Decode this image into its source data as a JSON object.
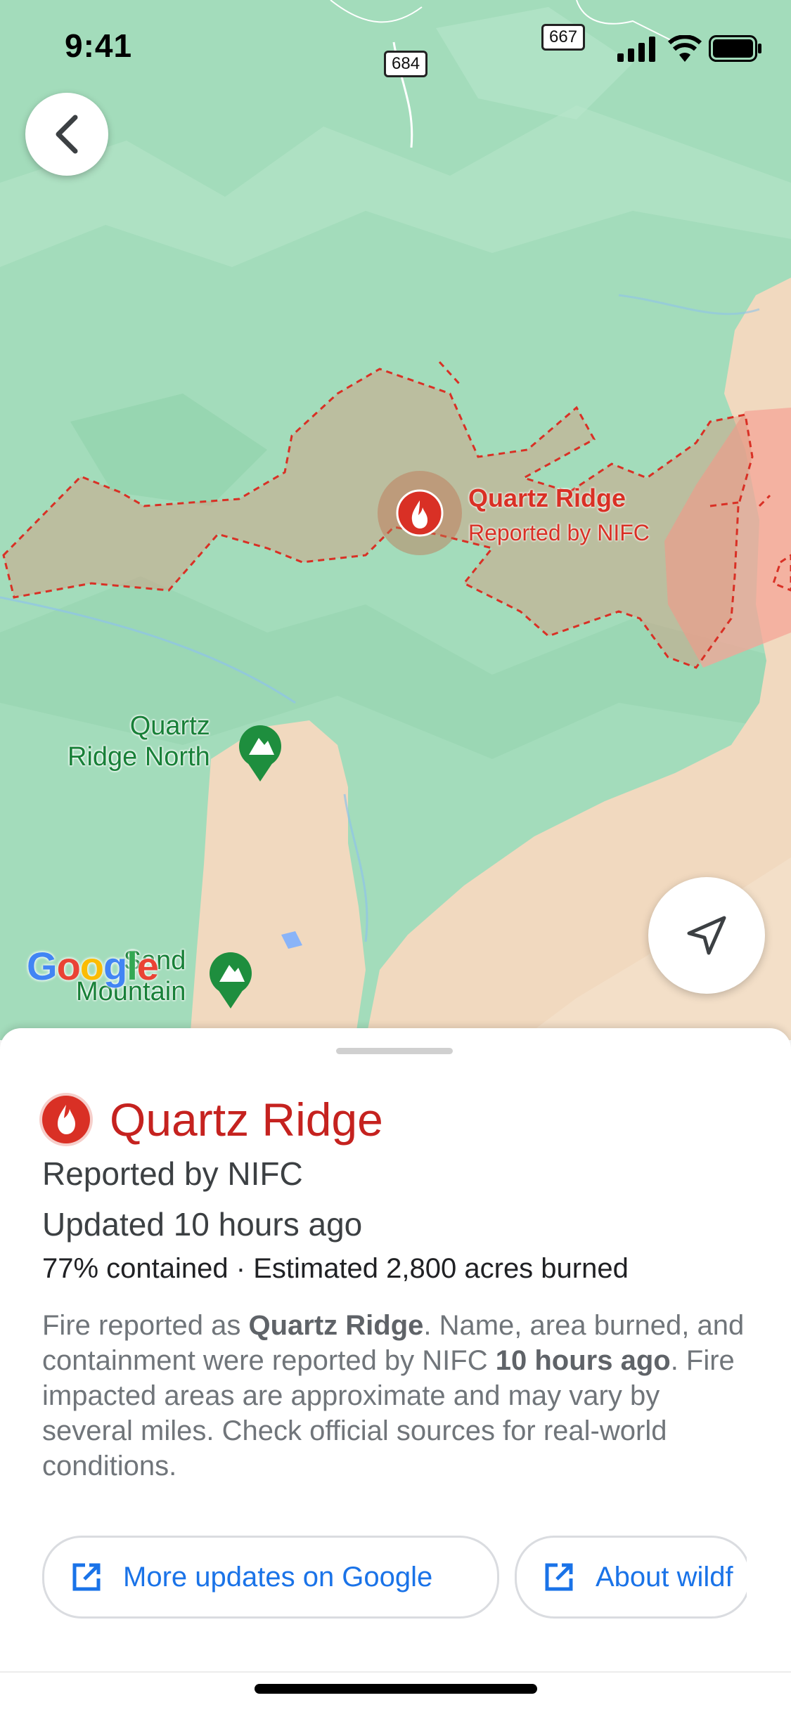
{
  "status_bar": {
    "time": "9:41"
  },
  "map": {
    "road_shields": [
      "684",
      "667"
    ],
    "fire_marker": {
      "title": "Quartz Ridge",
      "subtitle": "Reported by NIFC"
    },
    "pois": [
      {
        "line1": "Quartz",
        "line2": "Ridge North"
      },
      {
        "line1": "Sand",
        "line2": "Mountain"
      }
    ],
    "google_logo": [
      "G",
      "o",
      "o",
      "g",
      "l",
      "e"
    ],
    "colors": {
      "forest": "#9fdcb8",
      "fire": "#d93025",
      "poi": "#188038",
      "terrain": "#f1d9bf"
    }
  },
  "sheet": {
    "title": "Quartz Ridge",
    "reported_by": "Reported by NIFC",
    "updated": "Updated 10 hours ago",
    "stats": "77% contained · Estimated 2,800 acres burned",
    "desc": {
      "p1": "Fire reported as ",
      "b1": "Quartz Ridge",
      "p2": ". Name, area burned, and containment were reported by NIFC ",
      "b2": "10 hours ago",
      "p3": ". Fire impacted areas are approximate and may vary by several miles. Check official sources for real-world conditions."
    },
    "buttons": [
      {
        "label": "More updates on Google",
        "icon": "open-in-new-icon"
      },
      {
        "label": "About wildf",
        "icon": "open-in-new-icon"
      }
    ]
  }
}
